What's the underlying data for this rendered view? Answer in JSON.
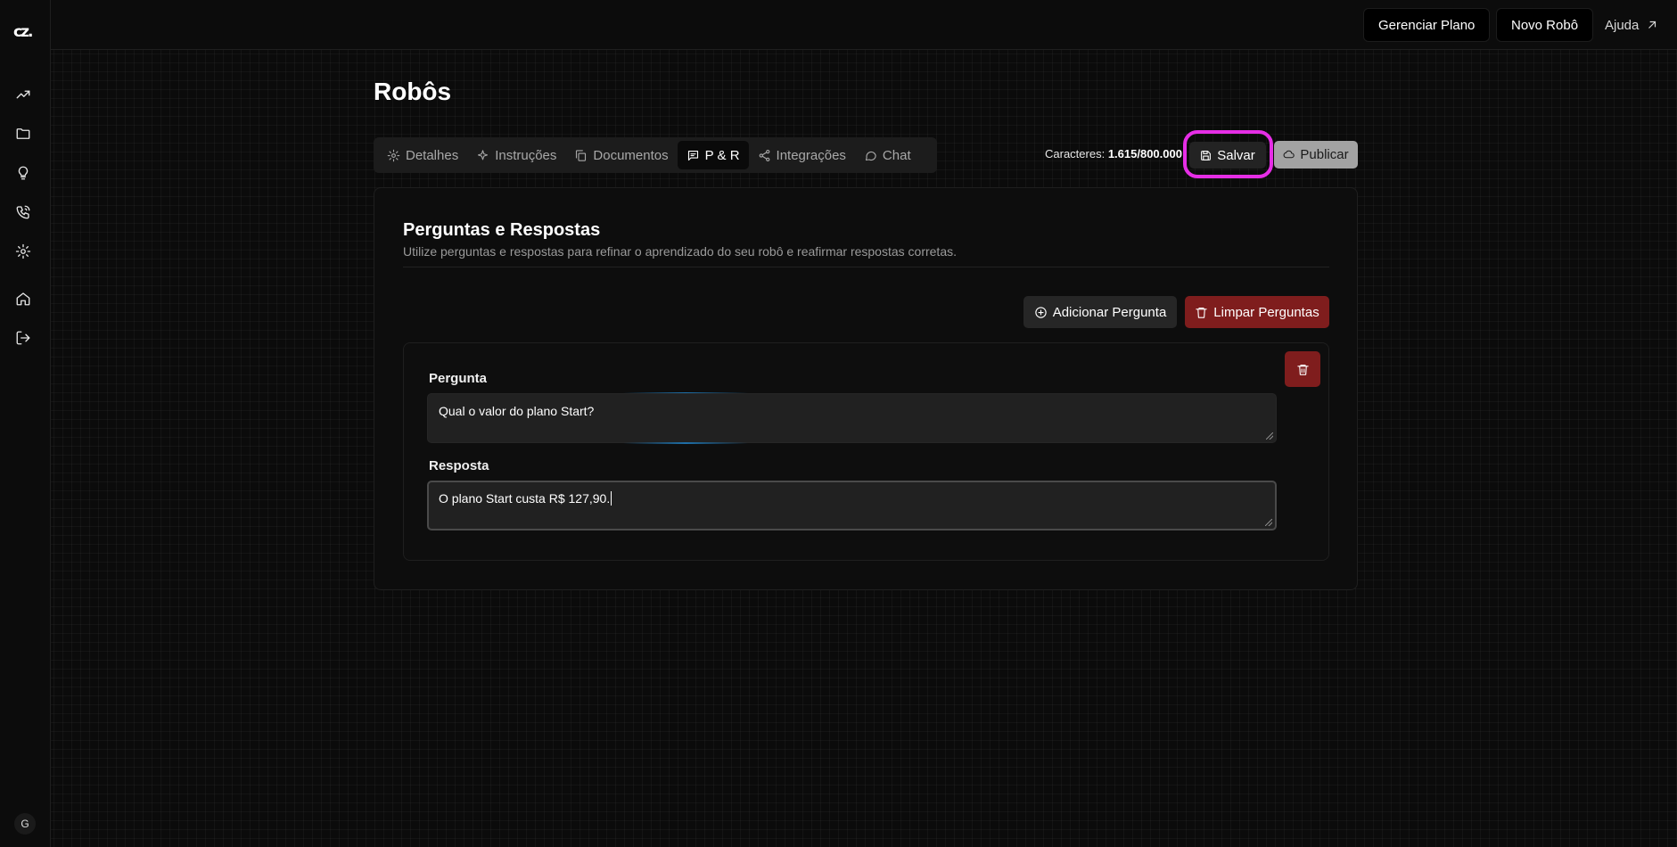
{
  "sidebar": {
    "logo": "cz.",
    "items": [
      {
        "icon": "trending-up-icon"
      },
      {
        "icon": "folder-icon"
      },
      {
        "icon": "lightbulb-icon"
      },
      {
        "icon": "phone-icon"
      },
      {
        "icon": "settings-icon"
      },
      {
        "icon": "home-icon"
      },
      {
        "icon": "logout-icon"
      }
    ],
    "avatar_initial": "G"
  },
  "topbar": {
    "manage_plan": "Gerenciar Plano",
    "new_robot": "Novo Robô",
    "help": "Ajuda"
  },
  "page": {
    "title": "Robôs"
  },
  "tabs": [
    {
      "label": "Detalhes",
      "icon": "gear-icon"
    },
    {
      "label": "Instruções",
      "icon": "sparkles-icon"
    },
    {
      "label": "Documentos",
      "icon": "copy-icon"
    },
    {
      "label": "P & R",
      "icon": "message-icon",
      "active": true
    },
    {
      "label": "Integrações",
      "icon": "share-icon"
    },
    {
      "label": "Chat",
      "icon": "chat-icon"
    }
  ],
  "toolbar": {
    "chars_label": "Caracteres:",
    "chars_value": "1.615/800.000",
    "save": "Salvar",
    "publish": "Publicar"
  },
  "panel": {
    "title": "Perguntas e Respostas",
    "subtitle": "Utilize perguntas e respostas para refinar o aprendizado do seu robô e reafirmar respostas corretas.",
    "add_question": "Adicionar Pergunta",
    "clear_questions": "Limpar Perguntas",
    "qa_items": [
      {
        "question_label": "Pergunta",
        "question": "Qual o valor do plano Start?",
        "answer_label": "Resposta",
        "answer": "O plano Start custa R$ 127,90."
      }
    ]
  },
  "colors": {
    "background": "#0b0b0b",
    "danger": "#7f1d1d",
    "highlight": "#e62ee6",
    "publish": "#a3a3a3"
  }
}
